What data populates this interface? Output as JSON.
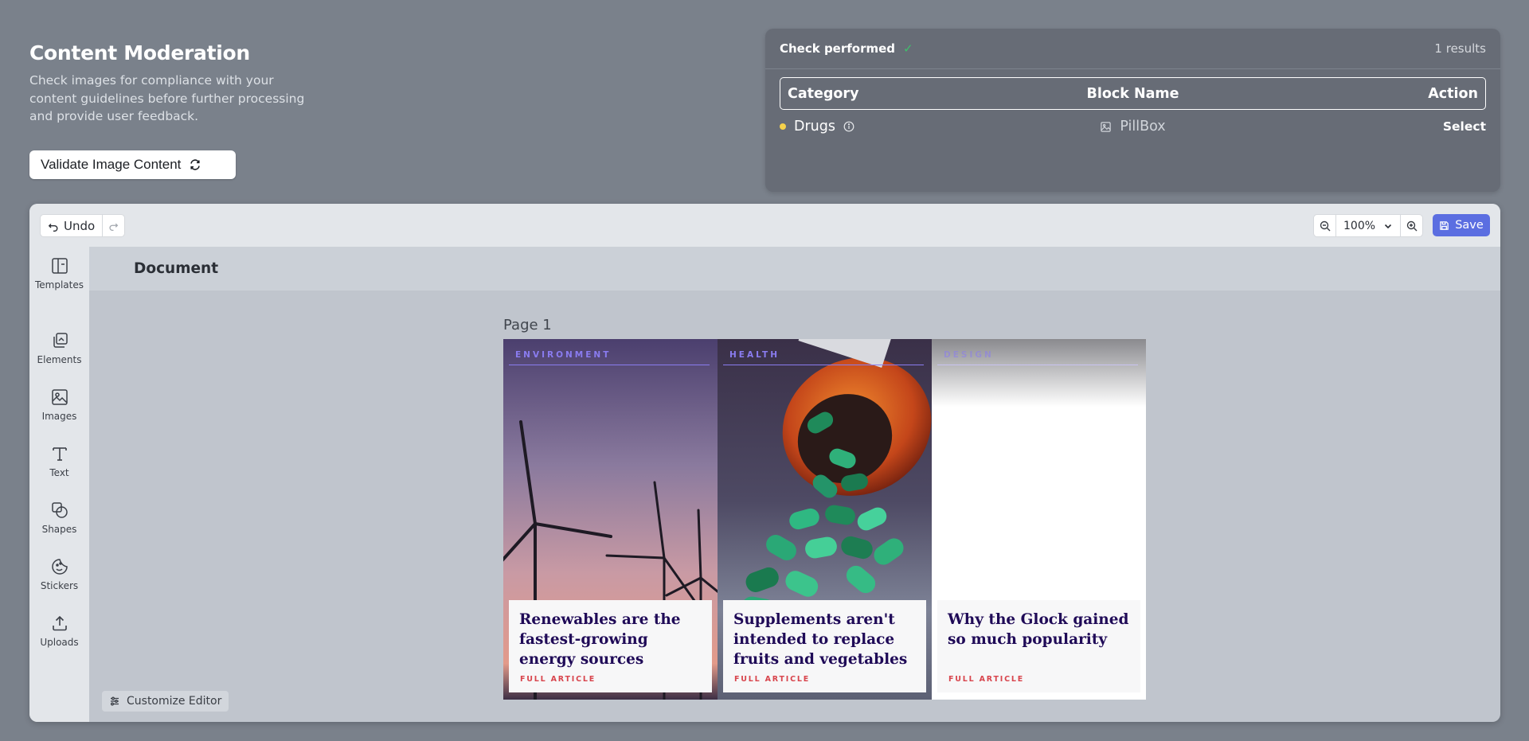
{
  "intro": {
    "title": "Content Moderation",
    "description": "Check images for compliance with your content guidelines before further processing and provide user feedback.",
    "validate_label": "Validate Image Content"
  },
  "results": {
    "status": "Check performed",
    "count": "1 results",
    "headers": {
      "category": "Category",
      "block_name": "Block Name",
      "action": "Action"
    },
    "rows": [
      {
        "category": "Drugs",
        "block_name": "PillBox",
        "action": "Select",
        "severity_color": "#f5d14b"
      }
    ]
  },
  "editor": {
    "undo_label": "Undo",
    "zoom_value": "100%",
    "save_label": "Save",
    "doc_title": "Document",
    "page_label": "Page 1",
    "customize_label": "Customize Editor",
    "sidebar": [
      {
        "label": "Templates",
        "icon": "templates-icon"
      },
      {
        "label": "Elements",
        "icon": "elements-icon"
      },
      {
        "label": "Images",
        "icon": "images-icon"
      },
      {
        "label": "Text",
        "icon": "text-icon"
      },
      {
        "label": "Shapes",
        "icon": "shapes-icon"
      },
      {
        "label": "Stickers",
        "icon": "stickers-icon"
      },
      {
        "label": "Uploads",
        "icon": "uploads-icon"
      }
    ],
    "cards": [
      {
        "tag": "ENVIRONMENT",
        "title": "Renewables are the fastest-growing energy sources",
        "link": "FULL ARTICLE"
      },
      {
        "tag": "HEALTH",
        "title": "Supplements aren't intended to replace fruits and vegetables",
        "link": "FULL ARTICLE"
      },
      {
        "tag": "DESIGN",
        "title": "Why the Glock gained so much popularity",
        "link": "FULL ARTICLE"
      }
    ]
  },
  "colors": {
    "accent": "#5b6ee1",
    "headline": "#1f0a57",
    "link": "#d8454d",
    "tag": "#8a7cf0"
  }
}
